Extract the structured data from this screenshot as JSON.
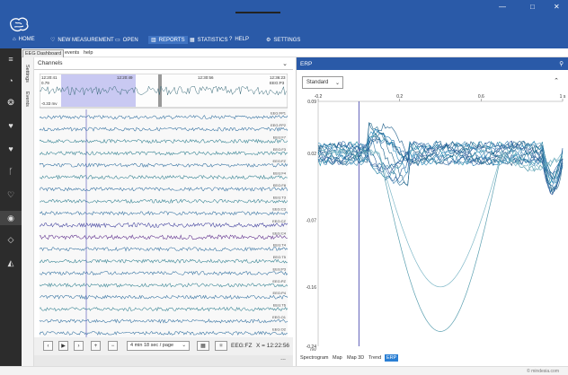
{
  "nav": {
    "items": [
      {
        "label": "HOME",
        "icon": "home-icon"
      },
      {
        "label": "NEW MEASUREMENT",
        "icon": "heart-icon"
      },
      {
        "label": "OPEN",
        "icon": "folder-icon"
      },
      {
        "label": "REPORTS",
        "icon": "chart-icon"
      },
      {
        "label": "STATISTICS",
        "icon": "grid-icon"
      },
      {
        "label": "HELP",
        "icon": "help-icon"
      },
      {
        "label": "SETTINGS",
        "icon": "gear-icon"
      }
    ],
    "active": "REPORTS"
  },
  "subtabs": {
    "dashboard": "EEG Dashboard",
    "events": "events",
    "help": "help"
  },
  "vtabs": {
    "settings": "Settings",
    "events": "Events"
  },
  "channels": {
    "title": "Channels",
    "overview": {
      "top_left": "12:20:41",
      "top_left_val": "0.79",
      "bottom_left": "-0.33 mv",
      "t2": "12:20:49",
      "t3": "12:30:56",
      "t4": "12:36:23",
      "t4_label": "EEG:P3"
    },
    "labels": [
      "EEG:FP1",
      "EEG:FP2",
      "EEG:F7",
      "EEG:F3",
      "EEG:FZ",
      "EEG:F4",
      "EEG:F8",
      "EEG:T3",
      "EEG:C3",
      "EEG:CZ",
      "EEG:C4",
      "EEG:T4",
      "EEG:T5",
      "EEG:P3",
      "EEG:PZ",
      "EEG:P4",
      "EEG:T6",
      "EEG:O1",
      "EEG:O2"
    ]
  },
  "controls": {
    "page": "4 min 18 sec / page",
    "channel_label": "EEG:FZ",
    "x_readout": "X = 12:22:56",
    "more": "..."
  },
  "erp": {
    "title": "ERP",
    "dropdown": "Standard",
    "x_ticks": [
      "-0.2",
      "0.2",
      "0.6",
      "1 s"
    ],
    "y_ticks": [
      "0.09",
      "0.02",
      "-0.07",
      "-0.16",
      "-0.24"
    ],
    "unit": "mV",
    "tabs": [
      "Spectrogram",
      "Map",
      "Map 3D",
      "Trend",
      "ERP"
    ],
    "active_tab": "ERP"
  },
  "footer": {
    "brand": "© mindesia.com"
  }
}
